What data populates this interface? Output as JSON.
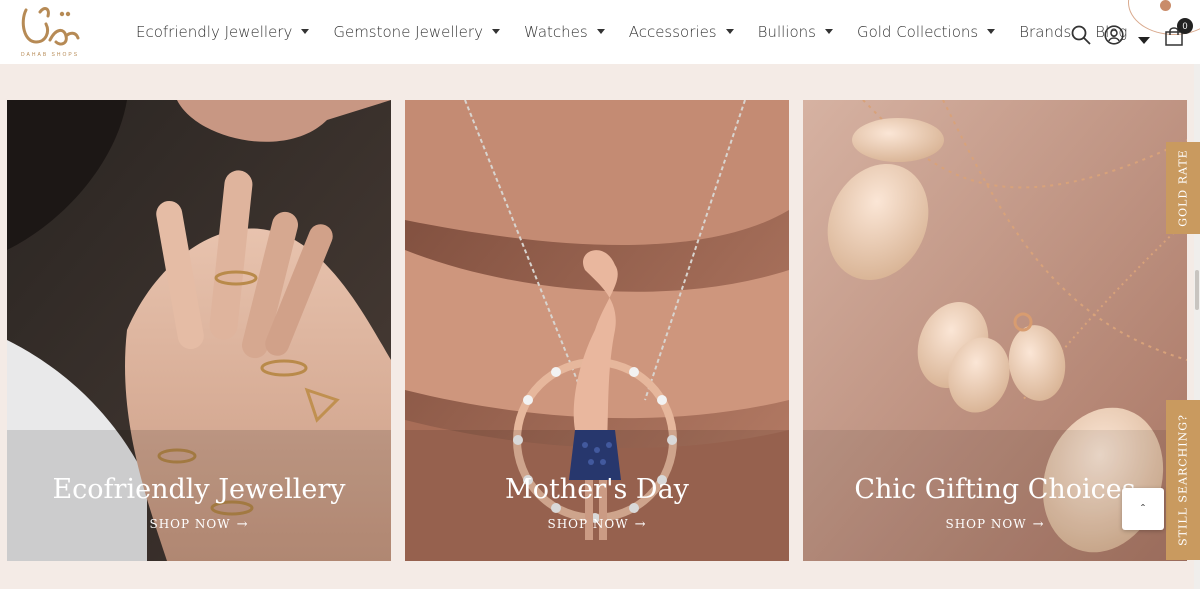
{
  "brand": {
    "logo_text": "DAHAB SHOPS"
  },
  "nav": {
    "items": [
      {
        "label": "Ecofriendly Jewellery",
        "dropdown": true
      },
      {
        "label": "Gemstone Jewellery",
        "dropdown": true
      },
      {
        "label": "Watches",
        "dropdown": true
      },
      {
        "label": "Accessories",
        "dropdown": true
      },
      {
        "label": "Bullions",
        "dropdown": true
      },
      {
        "label": "Gold Collections",
        "dropdown": true
      },
      {
        "label": "Brands",
        "dropdown": false
      },
      {
        "label": "Blog",
        "dropdown": false
      }
    ]
  },
  "header": {
    "cart_count": "0"
  },
  "banners": [
    {
      "title": "Ecofriendly Jewellery",
      "cta": "SHOP NOW"
    },
    {
      "title": "Mother's Day",
      "cta": "SHOP NOW"
    },
    {
      "title": "Chic Gifting Choices",
      "cta": "SHOP NOW"
    }
  ],
  "side_tabs": {
    "gold_rate": "GOLD RATE",
    "still_searching": "STILL SEARCHING?"
  },
  "colors": {
    "accent": "#c99a5f",
    "background": "#f4ebe6"
  },
  "icons": [
    "search-icon",
    "user-icon",
    "chevron-down-icon",
    "cart-icon",
    "arrow-right-icon",
    "chevron-up-icon"
  ]
}
